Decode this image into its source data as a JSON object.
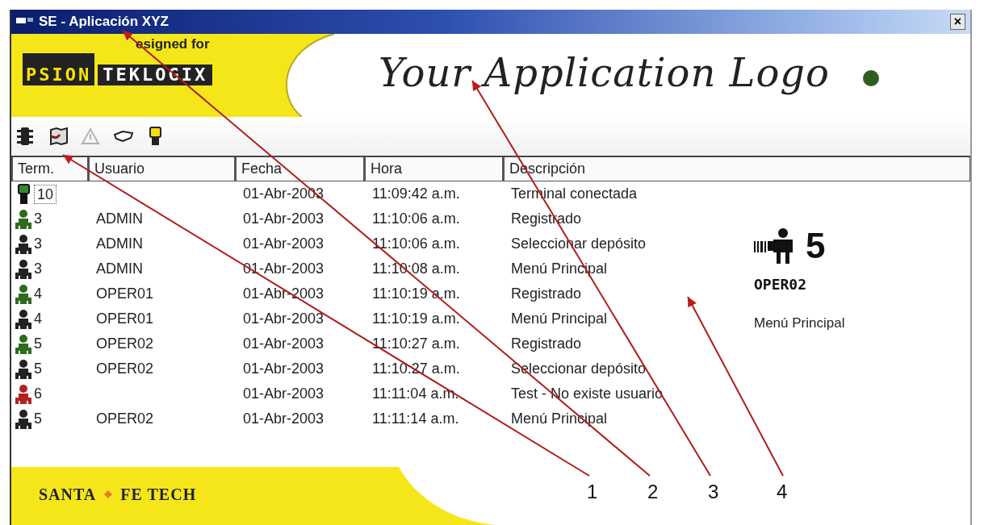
{
  "window": {
    "title": "SE - Aplicación XYZ",
    "close": "×"
  },
  "header": {
    "designed_for": "esigned for",
    "brand_left": "PSION",
    "brand_right": "TEKLOGIX",
    "app_logo": "Your Application Logo"
  },
  "toolbar": [
    {
      "kind": "traffic-light",
      "disabled": false
    },
    {
      "kind": "map",
      "disabled": false
    },
    {
      "kind": "warning",
      "disabled": true
    },
    {
      "kind": "hand",
      "disabled": false
    },
    {
      "kind": "terminal",
      "disabled": false
    }
  ],
  "table": {
    "columns": [
      "Term.",
      "Usuario",
      "Fecha",
      "Hora",
      "Descripción"
    ],
    "rows": [
      {
        "kind": "terminal",
        "color": "#2e8b2e",
        "focused": true,
        "cells": [
          "10",
          "",
          "01-Abr-2003",
          "11:09:42 a.m.",
          "Terminal conectada"
        ]
      },
      {
        "kind": "user",
        "color": "#2e6b1e",
        "focused": false,
        "cells": [
          "3",
          "ADMIN",
          "01-Abr-2003",
          "11:10:06 a.m.",
          "Registrado"
        ]
      },
      {
        "kind": "user",
        "color": "#222222",
        "focused": false,
        "cells": [
          "3",
          "ADMIN",
          "01-Abr-2003",
          "11:10:06 a.m.",
          "Seleccionar depósito"
        ]
      },
      {
        "kind": "user",
        "color": "#222222",
        "focused": false,
        "cells": [
          "3",
          "ADMIN",
          "01-Abr-2003",
          "11:10:08 a.m.",
          "Menú Principal"
        ]
      },
      {
        "kind": "user",
        "color": "#2e6b1e",
        "focused": false,
        "cells": [
          "4",
          "OPER01",
          "01-Abr-2003",
          "11:10:19 a.m.",
          "Registrado"
        ]
      },
      {
        "kind": "user",
        "color": "#222222",
        "focused": false,
        "cells": [
          "4",
          "OPER01",
          "01-Abr-2003",
          "11:10:19 a.m.",
          "Menú Principal"
        ]
      },
      {
        "kind": "user",
        "color": "#2e6b1e",
        "focused": false,
        "cells": [
          "5",
          "OPER02",
          "01-Abr-2003",
          "11:10:27 a.m.",
          "Registrado"
        ]
      },
      {
        "kind": "user",
        "color": "#222222",
        "focused": false,
        "cells": [
          "5",
          "OPER02",
          "01-Abr-2003",
          "11:10:27 a.m.",
          "Seleccionar depósito"
        ]
      },
      {
        "kind": "user",
        "color": "#b22222",
        "focused": false,
        "cells": [
          "6",
          "",
          "01-Abr-2003",
          "11:11:04 a.m.",
          "Test - No existe usuario"
        ]
      },
      {
        "kind": "user",
        "color": "#222222",
        "focused": false,
        "cells": [
          "5",
          "OPER02",
          "01-Abr-2003",
          "11:11:14 a.m.",
          "Menú Principal"
        ]
      }
    ]
  },
  "detail": {
    "terminal": "5",
    "user": "OPER02",
    "status": "Menú Principal"
  },
  "footer": {
    "left": "SANTA",
    "right": "FE TECH"
  },
  "annotations": [
    "1",
    "2",
    "3",
    "4"
  ]
}
